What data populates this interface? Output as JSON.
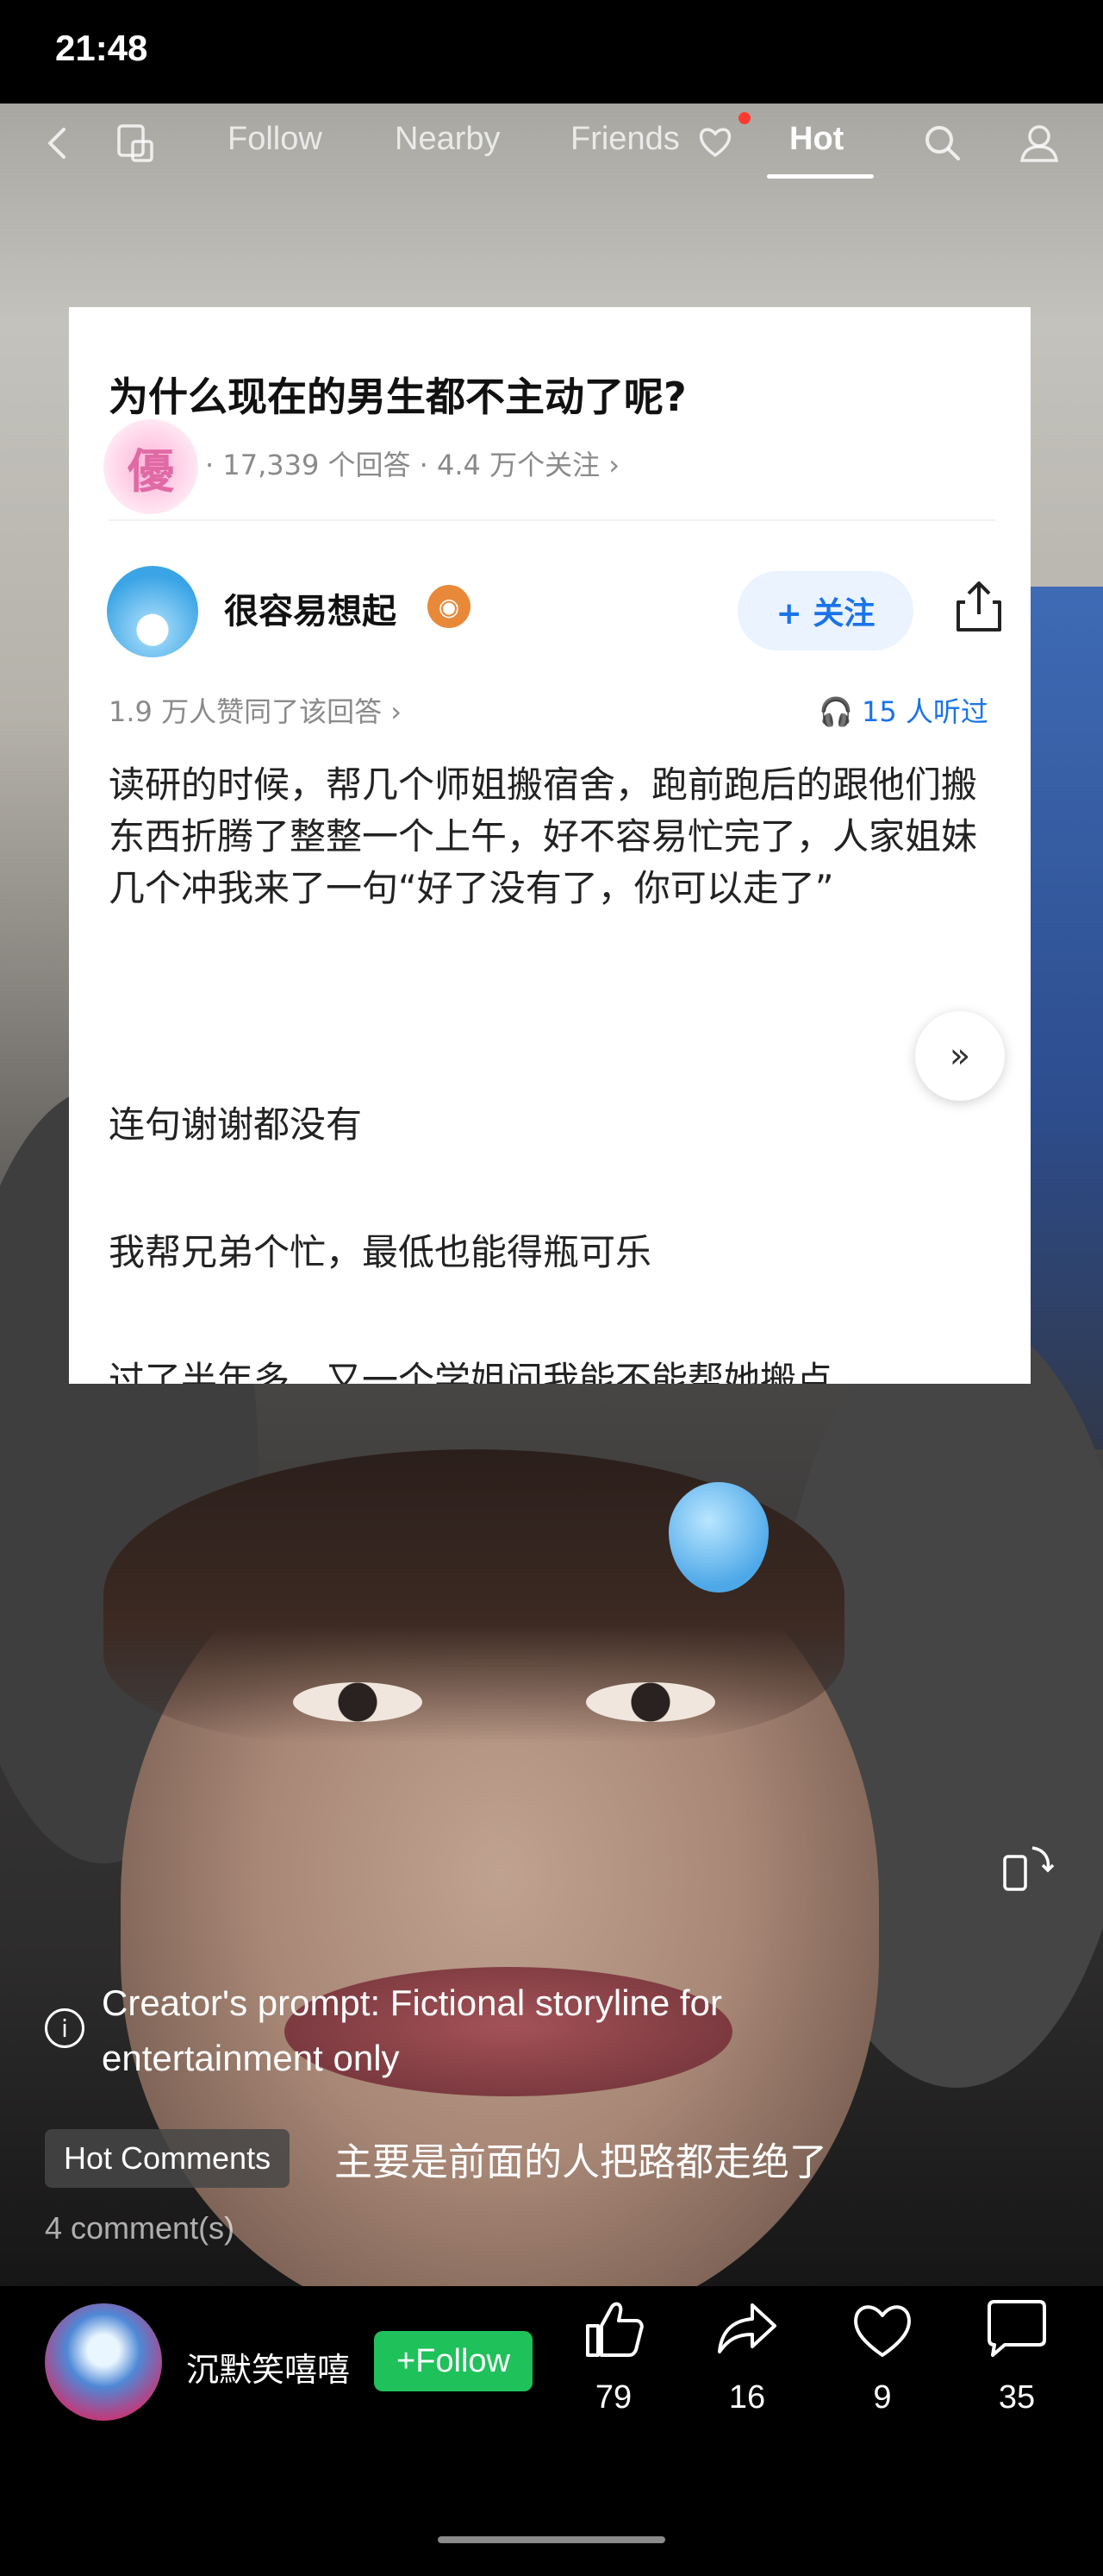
{
  "status_bar": {
    "time": "21:48"
  },
  "nav": {
    "tabs": [
      "Follow",
      "Nearby",
      "Friends",
      "Hot"
    ],
    "active": "Hot",
    "icons": [
      "back-icon",
      "mirror-icon",
      "heart-icon",
      "search-icon",
      "profile-icon"
    ]
  },
  "card": {
    "question": "为什么现在的男生都不主动了呢?",
    "badge": "優",
    "meta": "· 17,339 个回答 · 4.4 万个关注 ›",
    "author": "很容易想起",
    "follow_label": "+ 关注",
    "agree": "1.9 万人赞同了该回答 ›",
    "listen": "15 人听过",
    "paragraphs": [
      "读研的时候，帮几个师姐搬宿舍，跑前跑后的跟他们搬东西折腾了整整一个上午，好不容易忙完了，人家姐妹几个冲我来了一句“好了没有了，你可以走了”",
      "连句谢谢都没有",
      "我帮兄弟个忙，最低也能得瓶可乐",
      "过了半年多，又一个学姐问我能不能帮她搬点"
    ]
  },
  "notice": {
    "text": "Creator's prompt: Fictional storyline for entertainment only"
  },
  "comments": {
    "chip": "Hot Comments",
    "top_comment": "主要是前面的人把路都走绝了",
    "count": "4 comment(s)"
  },
  "footer": {
    "username": "沉默笑嘻嘻",
    "follow_label": "+Follow",
    "likes": "79",
    "shares": "16",
    "favorites": "9",
    "comments": "35"
  }
}
